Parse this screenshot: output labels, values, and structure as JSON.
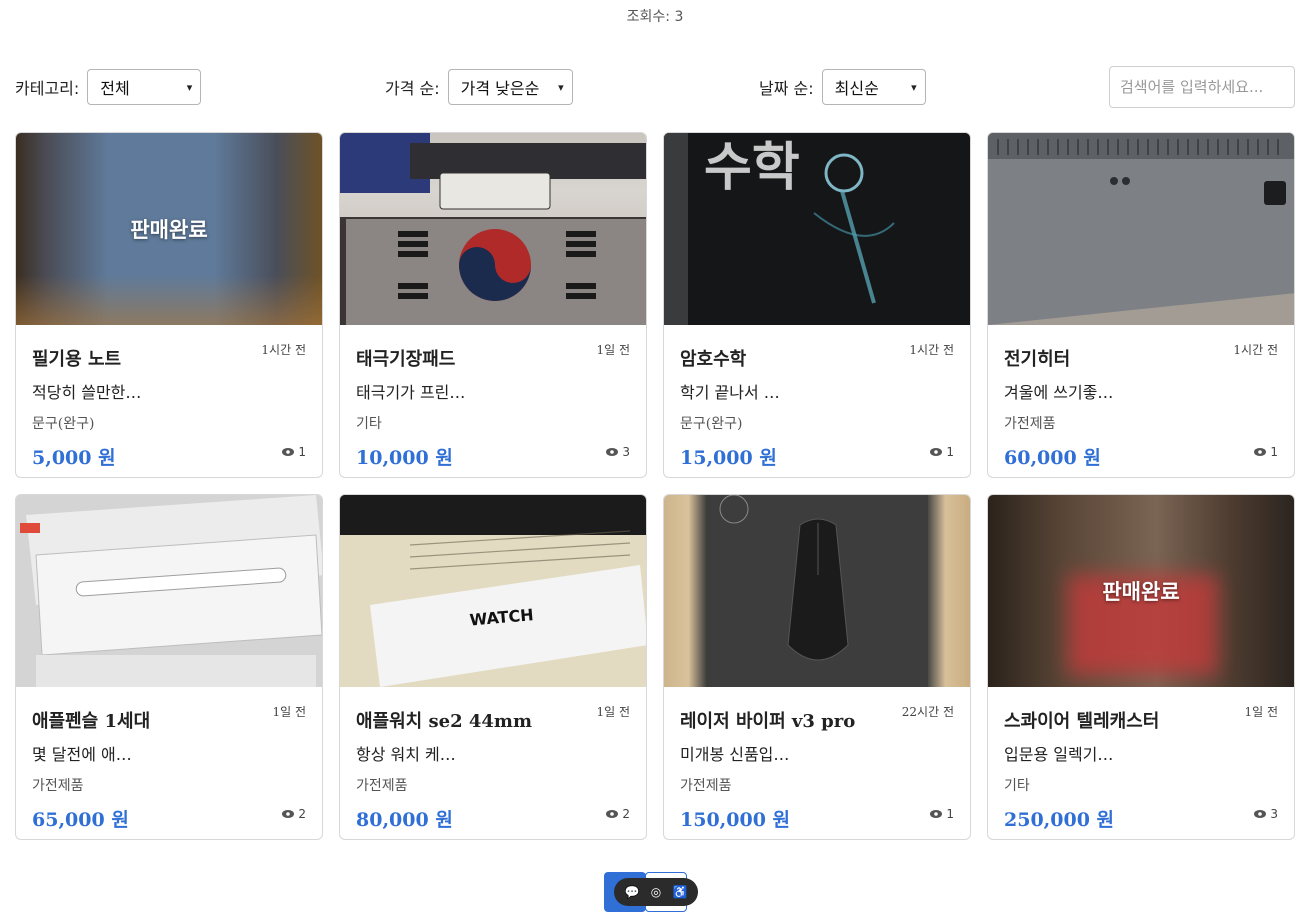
{
  "header": {
    "view_count": "조회수: 3"
  },
  "filters": {
    "category_label": "카테고리:",
    "category_value": "전체",
    "price_label": "가격 순:",
    "price_value": "가격 낮은순",
    "date_label": "날짜 순:",
    "date_value": "최신순",
    "search_placeholder": "검색어를 입력하세요..."
  },
  "products": [
    {
      "title": "필기용 노트",
      "time": "1시간 전",
      "desc": "적당히 쓸만한…",
      "category": "문구(완구)",
      "price": "5,000 원",
      "views": "1",
      "sold": "판매완료"
    },
    {
      "title": "태극기장패드",
      "time": "1일 전",
      "desc": "태극기가 프린…",
      "category": "기타",
      "price": "10,000 원",
      "views": "3"
    },
    {
      "title": "암호수학",
      "time": "1시간 전",
      "desc": "학기 끝나서 …",
      "category": "문구(완구)",
      "price": "15,000 원",
      "views": "1",
      "image_text": "수학"
    },
    {
      "title": "전기히터",
      "time": "1시간 전",
      "desc": "겨울에 쓰기좋…",
      "category": "가전제품",
      "price": "60,000 원",
      "views": "1"
    },
    {
      "title": "애플펜슬 1세대",
      "time": "1일 전",
      "desc": "몇 달전에 애…",
      "category": "가전제품",
      "price": "65,000 원",
      "views": "2"
    },
    {
      "title": "애플워치 se2 44mm",
      "time": "1일 전",
      "desc": "항상 워치 케…",
      "category": "가전제품",
      "price": "80,000 원",
      "views": "2",
      "image_text": "WATCH"
    },
    {
      "title": "레이저 바이퍼 v3 pro",
      "time": "22시간 전",
      "desc": "미개봉 신품입…",
      "category": "가전제품",
      "price": "150,000 원",
      "views": "1"
    },
    {
      "title": "스콰이어 텔레캐스터",
      "time": "1일 전",
      "desc": "입문용 일렉기…",
      "category": "기타",
      "price": "250,000 원",
      "views": "3",
      "sold": "판매완료"
    }
  ],
  "icons": {
    "chat": "chat-icon",
    "toggle": "toggle-icon",
    "accessibility": "accessibility-icon",
    "eye": "eye-icon",
    "chevron": "chevron-down-icon"
  },
  "colors": {
    "accent": "#2f6fd6",
    "price": "#2f6fd6"
  }
}
